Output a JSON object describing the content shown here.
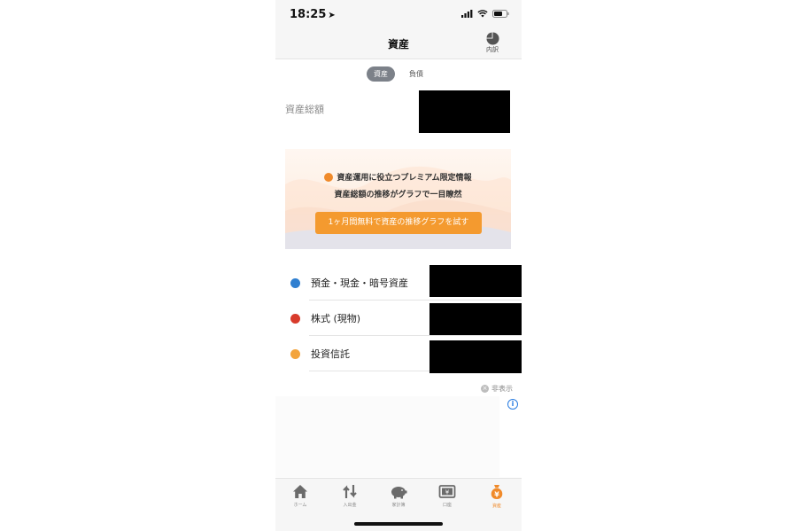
{
  "status_bar": {
    "time": "18:25",
    "location_glyph": "➤"
  },
  "nav": {
    "title": "資産",
    "breakdown_label": "内訳"
  },
  "segments": {
    "assets": "資産",
    "liabilities": "負債"
  },
  "total": {
    "label": "資産総額"
  },
  "promo": {
    "line1": "資産運用に役立つプレミアム限定情報",
    "line2": "資産総額の推移がグラフで一目瞭然",
    "button": "1ヶ月間無料で資産の推移グラフを試す"
  },
  "assets": [
    {
      "name": "預金・現金・暗号資産",
      "color": "#2f7fd0"
    },
    {
      "name": "株式 (現物)",
      "color": "#d83b2b"
    },
    {
      "name": "投資信託",
      "color": "#f3a43d"
    }
  ],
  "ad": {
    "hide_label": "非表示",
    "info_glyph": "i"
  },
  "tabs": [
    {
      "label": "ホーム",
      "icon": "home-icon"
    },
    {
      "label": "入出金",
      "icon": "transfer-arrows-icon"
    },
    {
      "label": "家計簿",
      "icon": "piggy-bank-icon"
    },
    {
      "label": "口座",
      "icon": "account-icon"
    },
    {
      "label": "資産",
      "icon": "money-bag-icon",
      "active": true
    }
  ],
  "colors": {
    "accent": "#f08a2a",
    "promo_button": "#f49a2f"
  }
}
